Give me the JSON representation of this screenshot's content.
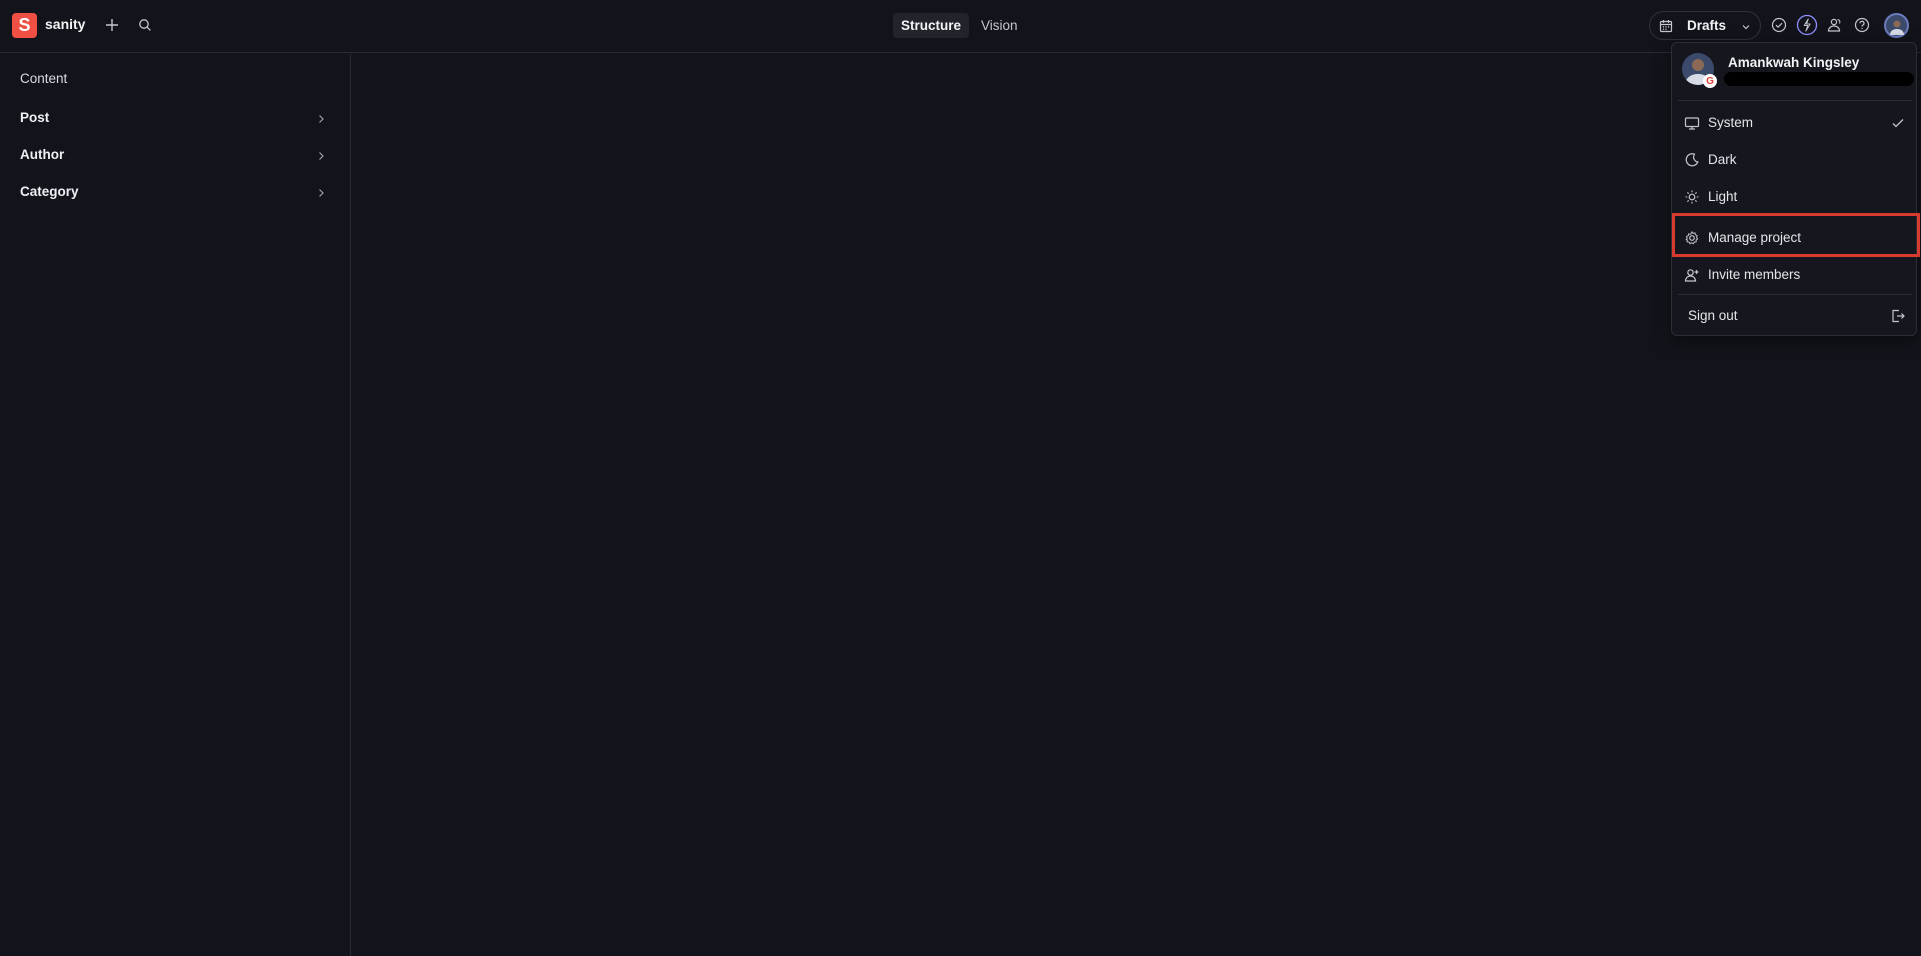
{
  "app": {
    "brand": "sanity",
    "logo_letter": "S",
    "accent_color": "#f04f44"
  },
  "header": {
    "tabs": [
      {
        "label": "Structure",
        "active": true
      },
      {
        "label": "Vision",
        "active": false
      }
    ],
    "perspective": {
      "label": "Drafts"
    },
    "icons": [
      "add-icon",
      "search-icon",
      "tasks-icon",
      "ai-assist-icon",
      "presence-icon",
      "help-icon",
      "user-avatar"
    ]
  },
  "sidebar": {
    "title": "Content",
    "items": [
      {
        "label": "Post"
      },
      {
        "label": "Author"
      },
      {
        "label": "Category"
      }
    ]
  },
  "user_menu": {
    "name": "Amankwah Kingsley",
    "auth_provider_badge": "G",
    "items": [
      {
        "label": "System",
        "icon": "desktop-icon",
        "checked": true
      },
      {
        "label": "Dark",
        "icon": "moon-icon"
      },
      {
        "label": "Light",
        "icon": "sun-icon"
      },
      {
        "label": "Manage project",
        "icon": "cog-icon",
        "highlighted": true
      },
      {
        "label": "Invite members",
        "icon": "add-user-icon"
      },
      {
        "label": "Sign out",
        "icon": "leave-icon"
      }
    ],
    "highlight_color": "#d83b2d"
  }
}
